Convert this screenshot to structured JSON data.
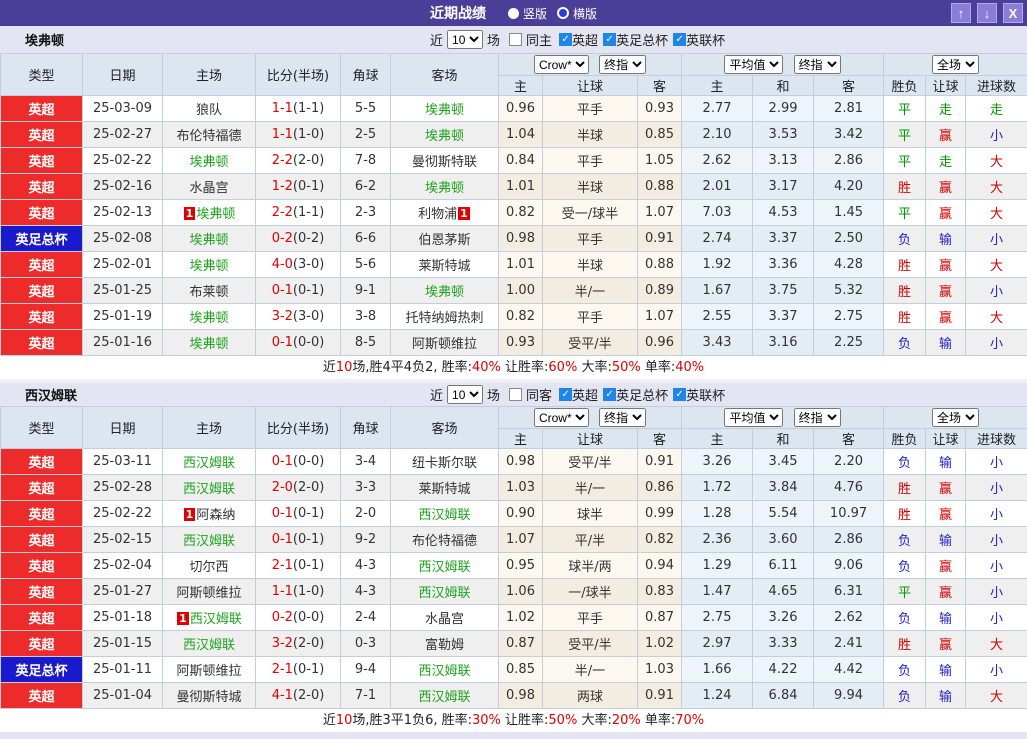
{
  "titlebar": {
    "title": "近期战绩",
    "radio_selected": "竖版",
    "radio_unselected": "横版",
    "up_button": "↑",
    "down_button": "↓",
    "close_button": "X"
  },
  "colors": {
    "topbar": "#4b3e99",
    "topbar_button": "#8a7cd8",
    "section_head": "#e4e4f2",
    "table_head": "#dce6f1",
    "epl_red": "#ee2b2b",
    "facup_blue": "#1a1acc",
    "team_highlight_green": "#1ea51e",
    "score_red": "#e10000",
    "checkbox_blue": "#1d86e8"
  },
  "league_colors": {
    "英超": "#ee2b2b",
    "英足总杯": "#1a1acc"
  },
  "result_colors": {
    "胜": "#d20000",
    "赢": "#d20000",
    "大": "#d20000",
    "平": "#009900",
    "走": "#009900",
    "负": "#2222cc",
    "输": "#2222cc",
    "小": "#2222cc"
  },
  "filters": {
    "near": "近",
    "count": "10",
    "matches": "场",
    "leagues": [
      "英超",
      "英足总杯",
      "英联杯"
    ]
  },
  "table_header": {
    "type": "类型",
    "date": "日期",
    "home": "主场",
    "score": "比分(半场)",
    "corner": "角球",
    "away": "客场",
    "odds_home": "主",
    "odds_handicap": "让球",
    "odds_away": "客",
    "avg_home": "主",
    "avg_draw": "和",
    "avg_away": "客",
    "res_wdl": "胜负",
    "res_handicap": "让球",
    "res_goals": "进球数",
    "dd_crow": "Crow*",
    "dd_final": "终指",
    "dd_avg": "平均值",
    "dd_scope": "全场"
  },
  "sections": [
    {
      "team": "埃弗顿",
      "venue_label": "同主",
      "rows": [
        {
          "league": "英超",
          "date": "25-03-09",
          "home": "狼队",
          "home_hl": false,
          "home_badge": "",
          "away": "埃弗顿",
          "away_hl": true,
          "away_badge": "",
          "score": "1-1",
          "half": "(1-1)",
          "corner": "5-5",
          "odds_home": "0.96",
          "handicap": "平手",
          "odds_away": "0.93",
          "avg_home": "2.77",
          "avg_draw": "2.99",
          "avg_away": "2.81",
          "res_wdl": "平",
          "res_handicap": "走",
          "res_goals": "走"
        },
        {
          "league": "英超",
          "date": "25-02-27",
          "home": "布伦特福德",
          "home_hl": false,
          "home_badge": "",
          "away": "埃弗顿",
          "away_hl": true,
          "away_badge": "",
          "score": "1-1",
          "half": "(1-0)",
          "corner": "2-5",
          "odds_home": "1.04",
          "handicap": "半球",
          "odds_away": "0.85",
          "avg_home": "2.10",
          "avg_draw": "3.53",
          "avg_away": "3.42",
          "res_wdl": "平",
          "res_handicap": "赢",
          "res_goals": "小"
        },
        {
          "league": "英超",
          "date": "25-02-22",
          "home": "埃弗顿",
          "home_hl": true,
          "home_badge": "",
          "away": "曼彻斯特联",
          "away_hl": false,
          "away_badge": "",
          "score": "2-2",
          "half": "(2-0)",
          "corner": "7-8",
          "odds_home": "0.84",
          "handicap": "平手",
          "odds_away": "1.05",
          "avg_home": "2.62",
          "avg_draw": "3.13",
          "avg_away": "2.86",
          "res_wdl": "平",
          "res_handicap": "走",
          "res_goals": "大"
        },
        {
          "league": "英超",
          "date": "25-02-16",
          "home": "水晶宫",
          "home_hl": false,
          "home_badge": "",
          "away": "埃弗顿",
          "away_hl": true,
          "away_badge": "",
          "score": "1-2",
          "half": "(0-1)",
          "corner": "6-2",
          "odds_home": "1.01",
          "handicap": "半球",
          "odds_away": "0.88",
          "avg_home": "2.01",
          "avg_draw": "3.17",
          "avg_away": "4.20",
          "res_wdl": "胜",
          "res_handicap": "赢",
          "res_goals": "大"
        },
        {
          "league": "英超",
          "date": "25-02-13",
          "home": "埃弗顿",
          "home_hl": true,
          "home_badge": "1",
          "away": "利物浦",
          "away_hl": false,
          "away_badge": "1",
          "score": "2-2",
          "half": "(1-1)",
          "corner": "2-3",
          "odds_home": "0.82",
          "handicap": "受一/球半",
          "odds_away": "1.07",
          "avg_home": "7.03",
          "avg_draw": "4.53",
          "avg_away": "1.45",
          "res_wdl": "平",
          "res_handicap": "赢",
          "res_goals": "大"
        },
        {
          "league": "英足总杯",
          "date": "25-02-08",
          "home": "埃弗顿",
          "home_hl": true,
          "home_badge": "",
          "away": "伯恩茅斯",
          "away_hl": false,
          "away_badge": "",
          "score": "0-2",
          "half": "(0-2)",
          "corner": "6-6",
          "odds_home": "0.98",
          "handicap": "平手",
          "odds_away": "0.91",
          "avg_home": "2.74",
          "avg_draw": "3.37",
          "avg_away": "2.50",
          "res_wdl": "负",
          "res_handicap": "输",
          "res_goals": "小"
        },
        {
          "league": "英超",
          "date": "25-02-01",
          "home": "埃弗顿",
          "home_hl": true,
          "home_badge": "",
          "away": "莱斯特城",
          "away_hl": false,
          "away_badge": "",
          "score": "4-0",
          "half": "(3-0)",
          "corner": "5-6",
          "odds_home": "1.01",
          "handicap": "半球",
          "odds_away": "0.88",
          "avg_home": "1.92",
          "avg_draw": "3.36",
          "avg_away": "4.28",
          "res_wdl": "胜",
          "res_handicap": "赢",
          "res_goals": "大"
        },
        {
          "league": "英超",
          "date": "25-01-25",
          "home": "布莱顿",
          "home_hl": false,
          "home_badge": "",
          "away": "埃弗顿",
          "away_hl": true,
          "away_badge": "",
          "score": "0-1",
          "half": "(0-1)",
          "corner": "9-1",
          "odds_home": "1.00",
          "handicap": "半/一",
          "odds_away": "0.89",
          "avg_home": "1.67",
          "avg_draw": "3.75",
          "avg_away": "5.32",
          "res_wdl": "胜",
          "res_handicap": "赢",
          "res_goals": "小"
        },
        {
          "league": "英超",
          "date": "25-01-19",
          "home": "埃弗顿",
          "home_hl": true,
          "home_badge": "",
          "away": "托特纳姆热刺",
          "away_hl": false,
          "away_badge": "",
          "score": "3-2",
          "half": "(3-0)",
          "corner": "3-8",
          "odds_home": "0.82",
          "handicap": "平手",
          "odds_away": "1.07",
          "avg_home": "2.55",
          "avg_draw": "3.37",
          "avg_away": "2.75",
          "res_wdl": "胜",
          "res_handicap": "赢",
          "res_goals": "大"
        },
        {
          "league": "英超",
          "date": "25-01-16",
          "home": "埃弗顿",
          "home_hl": true,
          "home_badge": "",
          "away": "阿斯顿维拉",
          "away_hl": false,
          "away_badge": "",
          "score": "0-1",
          "half": "(0-0)",
          "corner": "8-5",
          "odds_home": "0.93",
          "handicap": "受平/半",
          "odds_away": "0.96",
          "avg_home": "3.43",
          "avg_draw": "3.16",
          "avg_away": "2.25",
          "res_wdl": "负",
          "res_handicap": "输",
          "res_goals": "小"
        }
      ],
      "summary": [
        [
          "近",
          false
        ],
        [
          "10",
          true
        ],
        [
          "场,胜4平4负2, 胜率:",
          false
        ],
        [
          "40%",
          true
        ],
        [
          " 让胜率:",
          false
        ],
        [
          "60%",
          true
        ],
        [
          " 大率:",
          false
        ],
        [
          "50%",
          true
        ],
        [
          " 单率:",
          false
        ],
        [
          "40%",
          true
        ]
      ]
    },
    {
      "team": "西汉姆联",
      "venue_label": "同客",
      "rows": [
        {
          "league": "英超",
          "date": "25-03-11",
          "home": "西汉姆联",
          "home_hl": true,
          "home_badge": "",
          "away": "纽卡斯尔联",
          "away_hl": false,
          "away_badge": "",
          "score": "0-1",
          "half": "(0-0)",
          "corner": "3-4",
          "odds_home": "0.98",
          "handicap": "受平/半",
          "odds_away": "0.91",
          "avg_home": "3.26",
          "avg_draw": "3.45",
          "avg_away": "2.20",
          "res_wdl": "负",
          "res_handicap": "输",
          "res_goals": "小"
        },
        {
          "league": "英超",
          "date": "25-02-28",
          "home": "西汉姆联",
          "home_hl": true,
          "home_badge": "",
          "away": "莱斯特城",
          "away_hl": false,
          "away_badge": "",
          "score": "2-0",
          "half": "(2-0)",
          "corner": "3-3",
          "odds_home": "1.03",
          "handicap": "半/一",
          "odds_away": "0.86",
          "avg_home": "1.72",
          "avg_draw": "3.84",
          "avg_away": "4.76",
          "res_wdl": "胜",
          "res_handicap": "赢",
          "res_goals": "小"
        },
        {
          "league": "英超",
          "date": "25-02-22",
          "home": "阿森纳",
          "home_hl": false,
          "home_badge": "1",
          "away": "西汉姆联",
          "away_hl": true,
          "away_badge": "",
          "score": "0-1",
          "half": "(0-1)",
          "corner": "2-0",
          "odds_home": "0.90",
          "handicap": "球半",
          "odds_away": "0.99",
          "avg_home": "1.28",
          "avg_draw": "5.54",
          "avg_away": "10.97",
          "res_wdl": "胜",
          "res_handicap": "赢",
          "res_goals": "小"
        },
        {
          "league": "英超",
          "date": "25-02-15",
          "home": "西汉姆联",
          "home_hl": true,
          "home_badge": "",
          "away": "布伦特福德",
          "away_hl": false,
          "away_badge": "",
          "score": "0-1",
          "half": "(0-1)",
          "corner": "9-2",
          "odds_home": "1.07",
          "handicap": "平/半",
          "odds_away": "0.82",
          "avg_home": "2.36",
          "avg_draw": "3.60",
          "avg_away": "2.86",
          "res_wdl": "负",
          "res_handicap": "输",
          "res_goals": "小"
        },
        {
          "league": "英超",
          "date": "25-02-04",
          "home": "切尔西",
          "home_hl": false,
          "home_badge": "",
          "away": "西汉姆联",
          "away_hl": true,
          "away_badge": "",
          "score": "2-1",
          "half": "(0-1)",
          "corner": "4-3",
          "odds_home": "0.95",
          "handicap": "球半/两",
          "odds_away": "0.94",
          "avg_home": "1.29",
          "avg_draw": "6.11",
          "avg_away": "9.06",
          "res_wdl": "负",
          "res_handicap": "赢",
          "res_goals": "小"
        },
        {
          "league": "英超",
          "date": "25-01-27",
          "home": "阿斯顿维拉",
          "home_hl": false,
          "home_badge": "",
          "away": "西汉姆联",
          "away_hl": true,
          "away_badge": "",
          "score": "1-1",
          "half": "(1-0)",
          "corner": "4-3",
          "odds_home": "1.06",
          "handicap": "一/球半",
          "odds_away": "0.83",
          "avg_home": "1.47",
          "avg_draw": "4.65",
          "avg_away": "6.31",
          "res_wdl": "平",
          "res_handicap": "赢",
          "res_goals": "小"
        },
        {
          "league": "英超",
          "date": "25-01-18",
          "home": "西汉姆联",
          "home_hl": true,
          "home_badge": "1",
          "away": "水晶宫",
          "away_hl": false,
          "away_badge": "",
          "score": "0-2",
          "half": "(0-0)",
          "corner": "2-4",
          "odds_home": "1.02",
          "handicap": "平手",
          "odds_away": "0.87",
          "avg_home": "2.75",
          "avg_draw": "3.26",
          "avg_away": "2.62",
          "res_wdl": "负",
          "res_handicap": "输",
          "res_goals": "小"
        },
        {
          "league": "英超",
          "date": "25-01-15",
          "home": "西汉姆联",
          "home_hl": true,
          "home_badge": "",
          "away": "富勒姆",
          "away_hl": false,
          "away_badge": "",
          "score": "3-2",
          "half": "(2-0)",
          "corner": "0-3",
          "odds_home": "0.87",
          "handicap": "受平/半",
          "odds_away": "1.02",
          "avg_home": "2.97",
          "avg_draw": "3.33",
          "avg_away": "2.41",
          "res_wdl": "胜",
          "res_handicap": "赢",
          "res_goals": "大"
        },
        {
          "league": "英足总杯",
          "date": "25-01-11",
          "home": "阿斯顿维拉",
          "home_hl": false,
          "home_badge": "",
          "away": "西汉姆联",
          "away_hl": true,
          "away_badge": "",
          "score": "2-1",
          "half": "(0-1)",
          "corner": "9-4",
          "odds_home": "0.85",
          "handicap": "半/一",
          "odds_away": "1.03",
          "avg_home": "1.66",
          "avg_draw": "4.22",
          "avg_away": "4.42",
          "res_wdl": "负",
          "res_handicap": "输",
          "res_goals": "小"
        },
        {
          "league": "英超",
          "date": "25-01-04",
          "home": "曼彻斯特城",
          "home_hl": false,
          "home_badge": "",
          "away": "西汉姆联",
          "away_hl": true,
          "away_badge": "",
          "score": "4-1",
          "half": "(2-0)",
          "corner": "7-1",
          "odds_home": "0.98",
          "handicap": "两球",
          "odds_away": "0.91",
          "avg_home": "1.24",
          "avg_draw": "6.84",
          "avg_away": "9.94",
          "res_wdl": "负",
          "res_handicap": "输",
          "res_goals": "大"
        }
      ],
      "summary": [
        [
          "近",
          false
        ],
        [
          "10",
          true
        ],
        [
          "场,胜3平1负6, 胜率:",
          false
        ],
        [
          "30%",
          true
        ],
        [
          " 让胜率:",
          false
        ],
        [
          "50%",
          true
        ],
        [
          " 大率:",
          false
        ],
        [
          "20%",
          true
        ],
        [
          " 单率:",
          false
        ],
        [
          "70%",
          true
        ]
      ]
    }
  ]
}
